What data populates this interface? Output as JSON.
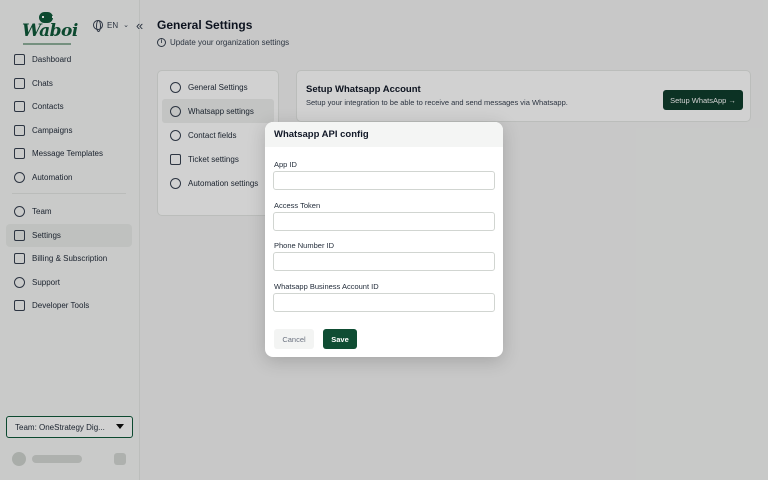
{
  "brand": {
    "logo_text": "Waboi",
    "accent_color": "#0f5a3a"
  },
  "language": {
    "code": "EN"
  },
  "sidebar": {
    "items": [
      {
        "label": "Dashboard",
        "icon": "home-icon"
      },
      {
        "label": "Chats",
        "icon": "chat-icon"
      },
      {
        "label": "Contacts",
        "icon": "contacts-icon"
      },
      {
        "label": "Campaigns",
        "icon": "campaigns-icon"
      },
      {
        "label": "Message Templates",
        "icon": "templates-icon"
      },
      {
        "label": "Automation",
        "icon": "automation-icon"
      },
      {
        "label": "Team",
        "icon": "team-icon"
      },
      {
        "label": "Settings",
        "icon": "sliders-icon",
        "active": true
      },
      {
        "label": "Billing & Subscription",
        "icon": "card-icon"
      },
      {
        "label": "Support",
        "icon": "lifebuoy-icon"
      },
      {
        "label": "Developer Tools",
        "icon": "api-icon"
      }
    ],
    "team_select": "Team: OneStrategy Dig..."
  },
  "header": {
    "title": "General Settings",
    "subtitle": "Update your organization settings"
  },
  "settings_menu": {
    "items": [
      {
        "label": "General Settings",
        "icon": "gear-icon"
      },
      {
        "label": "Whatsapp settings",
        "icon": "whatsapp-icon",
        "active": true
      },
      {
        "label": "Contact fields",
        "icon": "users-icon"
      },
      {
        "label": "Ticket settings",
        "icon": "ticket-icon"
      },
      {
        "label": "Automation settings",
        "icon": "automation-icon"
      }
    ]
  },
  "setup_card": {
    "title": "Setup Whatsapp Account",
    "description": "Setup your integration to be able to receive and send messages via Whatsapp.",
    "button_label": "Setup WhatsApp →"
  },
  "modal": {
    "title": "Whatsapp API config",
    "fields": [
      {
        "label": "App ID",
        "value": ""
      },
      {
        "label": "Access Token",
        "value": ""
      },
      {
        "label": "Phone Number ID",
        "value": ""
      },
      {
        "label": "Whatsapp Business Account ID",
        "value": ""
      }
    ],
    "cancel_label": "Cancel",
    "save_label": "Save"
  }
}
